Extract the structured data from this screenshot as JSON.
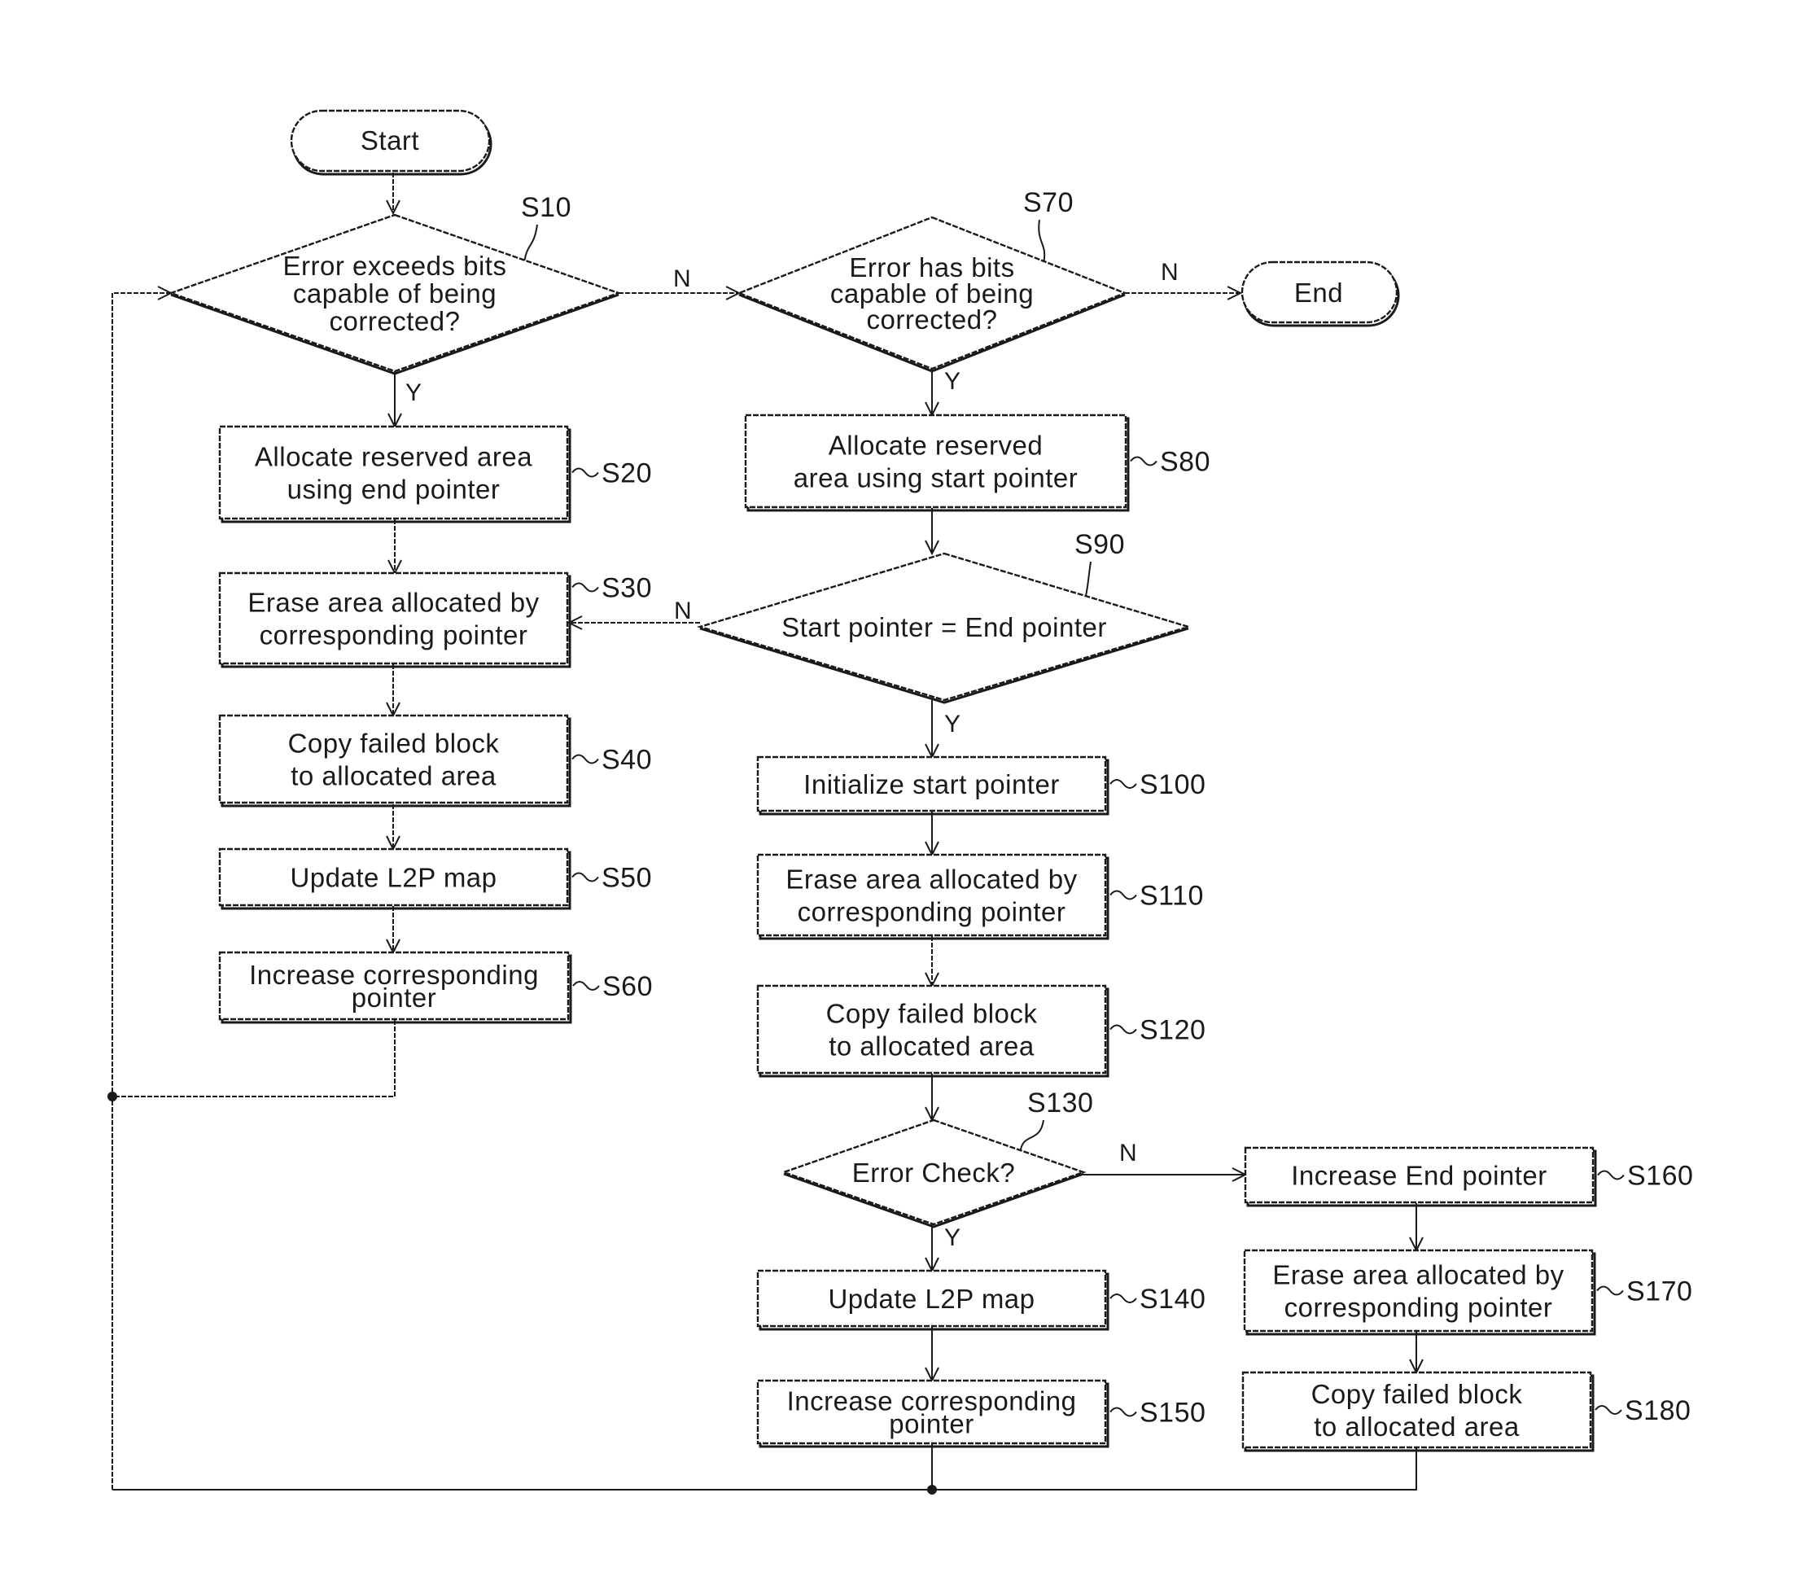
{
  "diagram": {
    "type": "flowchart",
    "terminals": {
      "start": "Start",
      "end": "End"
    },
    "steps": {
      "S10": {
        "id": "S10",
        "kind": "decision",
        "lines": [
          "Error exceeds bits",
          "capable of being",
          "corrected?"
        ]
      },
      "S20": {
        "id": "S20",
        "kind": "process",
        "lines": [
          "Allocate reserved area",
          "using end pointer"
        ]
      },
      "S30": {
        "id": "S30",
        "kind": "process",
        "lines": [
          "Erase area allocated by",
          "corresponding pointer"
        ]
      },
      "S40": {
        "id": "S40",
        "kind": "process",
        "lines": [
          "Copy failed block",
          "to allocated area"
        ]
      },
      "S50": {
        "id": "S50",
        "kind": "process",
        "lines": [
          "Update L2P map"
        ]
      },
      "S60": {
        "id": "S60",
        "kind": "process",
        "lines": [
          "Increase corresponding",
          "pointer"
        ]
      },
      "S70": {
        "id": "S70",
        "kind": "decision",
        "lines": [
          "Error has bits",
          "capable of being",
          "corrected?"
        ]
      },
      "S80": {
        "id": "S80",
        "kind": "process",
        "lines": [
          "Allocate reserved",
          "area using start pointer"
        ]
      },
      "S90": {
        "id": "S90",
        "kind": "decision",
        "lines": [
          "Start pointer = End pointer"
        ]
      },
      "S100": {
        "id": "S100",
        "kind": "process",
        "lines": [
          "Initialize start pointer"
        ]
      },
      "S110": {
        "id": "S110",
        "kind": "process",
        "lines": [
          "Erase area allocated by",
          "corresponding pointer"
        ]
      },
      "S120": {
        "id": "S120",
        "kind": "process",
        "lines": [
          "Copy failed block",
          "to allocated area"
        ]
      },
      "S130": {
        "id": "S130",
        "kind": "decision",
        "lines": [
          "Error Check?"
        ]
      },
      "S140": {
        "id": "S140",
        "kind": "process",
        "lines": [
          "Update L2P map"
        ]
      },
      "S150": {
        "id": "S150",
        "kind": "process",
        "lines": [
          "Increase corresponding",
          "pointer"
        ]
      },
      "S160": {
        "id": "S160",
        "kind": "process",
        "lines": [
          "Increase End pointer"
        ]
      },
      "S170": {
        "id": "S170",
        "kind": "process",
        "lines": [
          "Erase area allocated by",
          "corresponding pointer"
        ]
      },
      "S180": {
        "id": "S180",
        "kind": "process",
        "lines": [
          "Copy failed block",
          "to allocated area"
        ]
      }
    },
    "branch_labels": {
      "yes": "Y",
      "no": "N"
    },
    "edges": [
      {
        "from": "start",
        "to": "S10"
      },
      {
        "from": "S10",
        "to": "S20",
        "label": "Y"
      },
      {
        "from": "S10",
        "to": "S70",
        "label": "N"
      },
      {
        "from": "S20",
        "to": "S30"
      },
      {
        "from": "S30",
        "to": "S40"
      },
      {
        "from": "S40",
        "to": "S50"
      },
      {
        "from": "S50",
        "to": "S60"
      },
      {
        "from": "S60",
        "to": "S10"
      },
      {
        "from": "S70",
        "to": "S80",
        "label": "Y"
      },
      {
        "from": "S70",
        "to": "end",
        "label": "N"
      },
      {
        "from": "S80",
        "to": "S90"
      },
      {
        "from": "S90",
        "to": "S30",
        "label": "N"
      },
      {
        "from": "S90",
        "to": "S100",
        "label": "Y"
      },
      {
        "from": "S100",
        "to": "S110"
      },
      {
        "from": "S110",
        "to": "S120"
      },
      {
        "from": "S120",
        "to": "S130"
      },
      {
        "from": "S130",
        "to": "S140",
        "label": "Y"
      },
      {
        "from": "S130",
        "to": "S160",
        "label": "N"
      },
      {
        "from": "S140",
        "to": "S150"
      },
      {
        "from": "S150",
        "to": "S10"
      },
      {
        "from": "S160",
        "to": "S170"
      },
      {
        "from": "S170",
        "to": "S180"
      },
      {
        "from": "S180",
        "to": "S10"
      }
    ]
  }
}
